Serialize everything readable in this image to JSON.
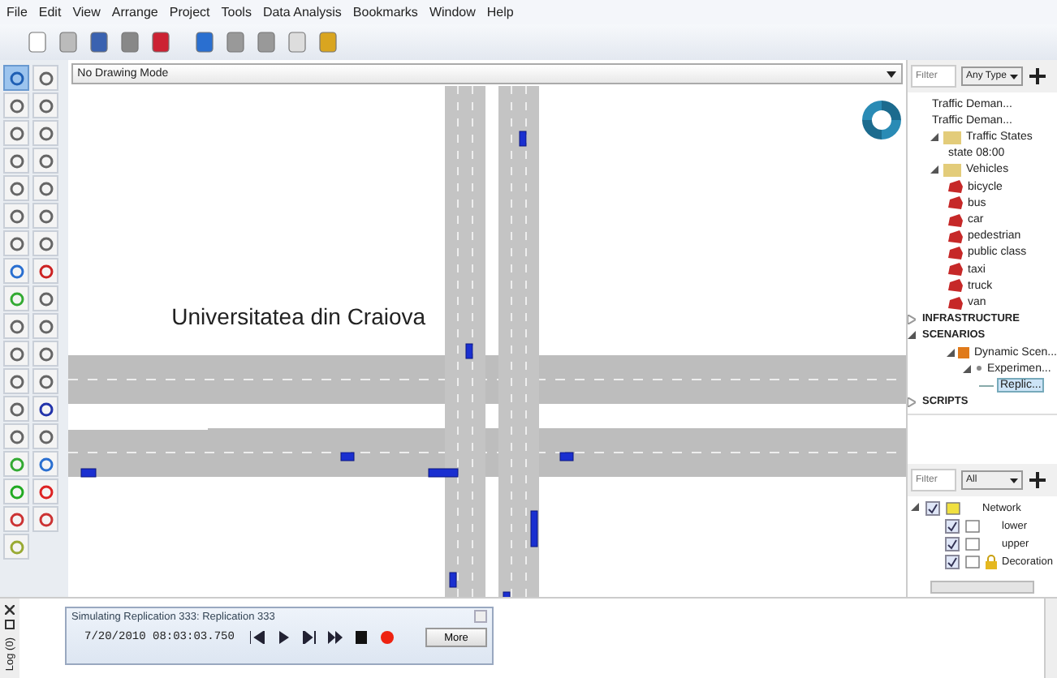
{
  "menu": [
    "File",
    "Edit",
    "View",
    "Arrange",
    "Project",
    "Tools",
    "Data Analysis",
    "Bookmarks",
    "Window",
    "Help"
  ],
  "drawing_mode": {
    "value": "No Drawing Mode"
  },
  "canvas": {
    "label": "Universitatea din Craiova"
  },
  "project": {
    "filter": {
      "placeholder": "Filter"
    },
    "type": {
      "value": "Any Type"
    },
    "tree": [
      {
        "label": "Traffic Deman...",
        "kind": "item",
        "selected": false
      },
      {
        "label": "Traffic Deman...",
        "kind": "item",
        "selected": false
      },
      {
        "label": "Traffic States",
        "kind": "folder",
        "expanded": true,
        "selected": false,
        "children": [
          {
            "label": "state 08:00",
            "kind": "item",
            "selected": false
          }
        ]
      },
      {
        "label": "Vehicles",
        "kind": "folder",
        "expanded": true,
        "selected": false,
        "children": [
          {
            "label": "bicycle",
            "kind": "vehicle",
            "selected": false
          },
          {
            "label": "bus",
            "kind": "vehicle",
            "selected": false
          },
          {
            "label": "car",
            "kind": "vehicle",
            "selected": false
          },
          {
            "label": "pedestrian",
            "kind": "vehicle",
            "selected": false
          },
          {
            "label": "public class",
            "kind": "vehicle",
            "selected": false
          },
          {
            "label": "taxi",
            "kind": "vehicle",
            "selected": false
          },
          {
            "label": "truck",
            "kind": "vehicle",
            "selected": false
          },
          {
            "label": "van",
            "kind": "vehicle",
            "selected": false
          }
        ]
      },
      {
        "label": "INFRASTRUCTURE",
        "kind": "section",
        "expanded": false,
        "selected": false
      },
      {
        "label": "SCENARIOS",
        "kind": "section",
        "expanded": true,
        "selected": false,
        "children": [
          {
            "label": "Dynamic Scen...",
            "kind": "scenario",
            "expanded": true,
            "selected": false,
            "children": [
              {
                "label": "Experimen...",
                "kind": "experiment",
                "expanded": true,
                "selected": false,
                "children": [
                  {
                    "label": "Replic...",
                    "kind": "replication",
                    "selected": true
                  }
                ]
              }
            ]
          }
        ]
      },
      {
        "label": "SCRIPTS",
        "kind": "section",
        "expanded": false,
        "selected": false
      }
    ]
  },
  "layers": {
    "filter": {
      "placeholder": "Filter"
    },
    "type": {
      "value": "All"
    },
    "rows": [
      {
        "label": "Network",
        "checked": true,
        "expanded": true,
        "locked": false,
        "kind": "root"
      },
      {
        "label": "lower",
        "checked": true,
        "locked": false,
        "kind": "layer"
      },
      {
        "label": "upper",
        "checked": true,
        "locked": false,
        "kind": "layer"
      },
      {
        "label": "Decoration",
        "checked": true,
        "locked": true,
        "kind": "layer"
      }
    ]
  },
  "log": {
    "tab": "Log (0)"
  },
  "simulation": {
    "title": "Simulating Replication 333: Replication 333",
    "time": "7/20/2010 08:03:03.750",
    "more": "More"
  }
}
